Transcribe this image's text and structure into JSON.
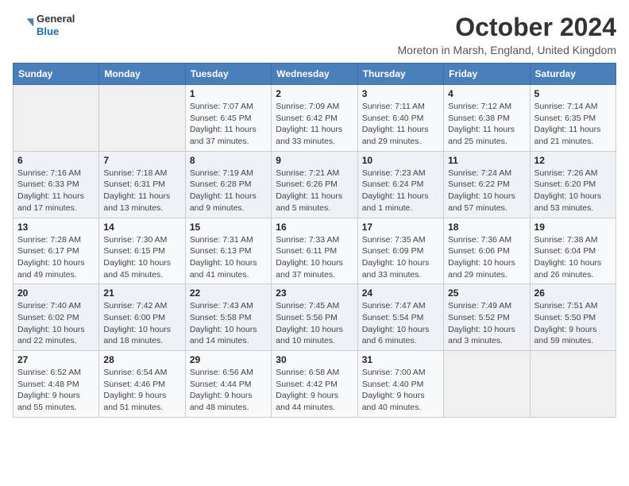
{
  "logo": {
    "general": "General",
    "blue": "Blue"
  },
  "title": "October 2024",
  "subtitle": "Moreton in Marsh, England, United Kingdom",
  "days_of_week": [
    "Sunday",
    "Monday",
    "Tuesday",
    "Wednesday",
    "Thursday",
    "Friday",
    "Saturday"
  ],
  "weeks": [
    [
      {
        "day": "",
        "sunrise": "",
        "sunset": "",
        "daylight": ""
      },
      {
        "day": "",
        "sunrise": "",
        "sunset": "",
        "daylight": ""
      },
      {
        "day": "1",
        "sunrise": "Sunrise: 7:07 AM",
        "sunset": "Sunset: 6:45 PM",
        "daylight": "Daylight: 11 hours and 37 minutes."
      },
      {
        "day": "2",
        "sunrise": "Sunrise: 7:09 AM",
        "sunset": "Sunset: 6:42 PM",
        "daylight": "Daylight: 11 hours and 33 minutes."
      },
      {
        "day": "3",
        "sunrise": "Sunrise: 7:11 AM",
        "sunset": "Sunset: 6:40 PM",
        "daylight": "Daylight: 11 hours and 29 minutes."
      },
      {
        "day": "4",
        "sunrise": "Sunrise: 7:12 AM",
        "sunset": "Sunset: 6:38 PM",
        "daylight": "Daylight: 11 hours and 25 minutes."
      },
      {
        "day": "5",
        "sunrise": "Sunrise: 7:14 AM",
        "sunset": "Sunset: 6:35 PM",
        "daylight": "Daylight: 11 hours and 21 minutes."
      }
    ],
    [
      {
        "day": "6",
        "sunrise": "Sunrise: 7:16 AM",
        "sunset": "Sunset: 6:33 PM",
        "daylight": "Daylight: 11 hours and 17 minutes."
      },
      {
        "day": "7",
        "sunrise": "Sunrise: 7:18 AM",
        "sunset": "Sunset: 6:31 PM",
        "daylight": "Daylight: 11 hours and 13 minutes."
      },
      {
        "day": "8",
        "sunrise": "Sunrise: 7:19 AM",
        "sunset": "Sunset: 6:28 PM",
        "daylight": "Daylight: 11 hours and 9 minutes."
      },
      {
        "day": "9",
        "sunrise": "Sunrise: 7:21 AM",
        "sunset": "Sunset: 6:26 PM",
        "daylight": "Daylight: 11 hours and 5 minutes."
      },
      {
        "day": "10",
        "sunrise": "Sunrise: 7:23 AM",
        "sunset": "Sunset: 6:24 PM",
        "daylight": "Daylight: 11 hours and 1 minute."
      },
      {
        "day": "11",
        "sunrise": "Sunrise: 7:24 AM",
        "sunset": "Sunset: 6:22 PM",
        "daylight": "Daylight: 10 hours and 57 minutes."
      },
      {
        "day": "12",
        "sunrise": "Sunrise: 7:26 AM",
        "sunset": "Sunset: 6:20 PM",
        "daylight": "Daylight: 10 hours and 53 minutes."
      }
    ],
    [
      {
        "day": "13",
        "sunrise": "Sunrise: 7:28 AM",
        "sunset": "Sunset: 6:17 PM",
        "daylight": "Daylight: 10 hours and 49 minutes."
      },
      {
        "day": "14",
        "sunrise": "Sunrise: 7:30 AM",
        "sunset": "Sunset: 6:15 PM",
        "daylight": "Daylight: 10 hours and 45 minutes."
      },
      {
        "day": "15",
        "sunrise": "Sunrise: 7:31 AM",
        "sunset": "Sunset: 6:13 PM",
        "daylight": "Daylight: 10 hours and 41 minutes."
      },
      {
        "day": "16",
        "sunrise": "Sunrise: 7:33 AM",
        "sunset": "Sunset: 6:11 PM",
        "daylight": "Daylight: 10 hours and 37 minutes."
      },
      {
        "day": "17",
        "sunrise": "Sunrise: 7:35 AM",
        "sunset": "Sunset: 6:09 PM",
        "daylight": "Daylight: 10 hours and 33 minutes."
      },
      {
        "day": "18",
        "sunrise": "Sunrise: 7:36 AM",
        "sunset": "Sunset: 6:06 PM",
        "daylight": "Daylight: 10 hours and 29 minutes."
      },
      {
        "day": "19",
        "sunrise": "Sunrise: 7:38 AM",
        "sunset": "Sunset: 6:04 PM",
        "daylight": "Daylight: 10 hours and 26 minutes."
      }
    ],
    [
      {
        "day": "20",
        "sunrise": "Sunrise: 7:40 AM",
        "sunset": "Sunset: 6:02 PM",
        "daylight": "Daylight: 10 hours and 22 minutes."
      },
      {
        "day": "21",
        "sunrise": "Sunrise: 7:42 AM",
        "sunset": "Sunset: 6:00 PM",
        "daylight": "Daylight: 10 hours and 18 minutes."
      },
      {
        "day": "22",
        "sunrise": "Sunrise: 7:43 AM",
        "sunset": "Sunset: 5:58 PM",
        "daylight": "Daylight: 10 hours and 14 minutes."
      },
      {
        "day": "23",
        "sunrise": "Sunrise: 7:45 AM",
        "sunset": "Sunset: 5:56 PM",
        "daylight": "Daylight: 10 hours and 10 minutes."
      },
      {
        "day": "24",
        "sunrise": "Sunrise: 7:47 AM",
        "sunset": "Sunset: 5:54 PM",
        "daylight": "Daylight: 10 hours and 6 minutes."
      },
      {
        "day": "25",
        "sunrise": "Sunrise: 7:49 AM",
        "sunset": "Sunset: 5:52 PM",
        "daylight": "Daylight: 10 hours and 3 minutes."
      },
      {
        "day": "26",
        "sunrise": "Sunrise: 7:51 AM",
        "sunset": "Sunset: 5:50 PM",
        "daylight": "Daylight: 9 hours and 59 minutes."
      }
    ],
    [
      {
        "day": "27",
        "sunrise": "Sunrise: 6:52 AM",
        "sunset": "Sunset: 4:48 PM",
        "daylight": "Daylight: 9 hours and 55 minutes."
      },
      {
        "day": "28",
        "sunrise": "Sunrise: 6:54 AM",
        "sunset": "Sunset: 4:46 PM",
        "daylight": "Daylight: 9 hours and 51 minutes."
      },
      {
        "day": "29",
        "sunrise": "Sunrise: 6:56 AM",
        "sunset": "Sunset: 4:44 PM",
        "daylight": "Daylight: 9 hours and 48 minutes."
      },
      {
        "day": "30",
        "sunrise": "Sunrise: 6:58 AM",
        "sunset": "Sunset: 4:42 PM",
        "daylight": "Daylight: 9 hours and 44 minutes."
      },
      {
        "day": "31",
        "sunrise": "Sunrise: 7:00 AM",
        "sunset": "Sunset: 4:40 PM",
        "daylight": "Daylight: 9 hours and 40 minutes."
      },
      {
        "day": "",
        "sunrise": "",
        "sunset": "",
        "daylight": ""
      },
      {
        "day": "",
        "sunrise": "",
        "sunset": "",
        "daylight": ""
      }
    ]
  ]
}
